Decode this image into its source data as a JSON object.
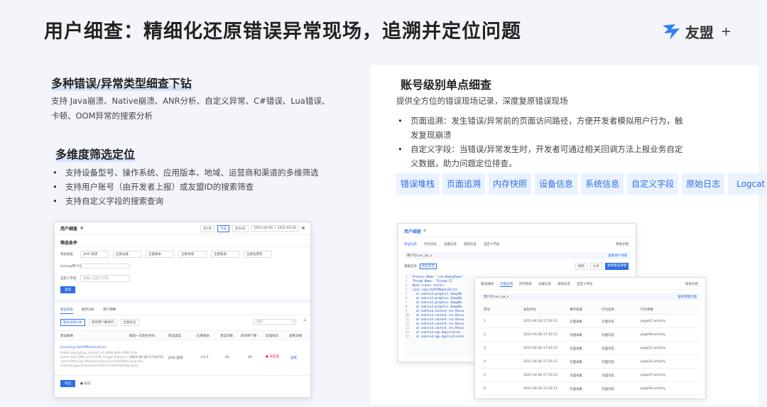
{
  "slide": {
    "title": "用户细查：精细化还原错误异常现场，追溯并定位问题"
  },
  "logo": {
    "name": "友盟",
    "plus": "+"
  },
  "left": {
    "section1": {
      "title": "多种错误/异常类型细查下钻",
      "desc": [
        "支持 Java崩溃、Native崩溃、ANR分析、自定义异常、C#错误、Lua错误、",
        "卡顿、OOM异常的搜索分析"
      ]
    },
    "section2": {
      "title": "多维度筛选定位",
      "bullets": [
        "支持设备型号、操作系统、应用版本、地域、运营商和渠道的多维筛选",
        "支持用户账号（由开发者上报）或友盟ID的搜索筛查",
        "支持自定义字段的搜索查询"
      ]
    }
  },
  "right": {
    "title": "账号级别单点细查",
    "desc": "提供全方位的错误现场记录，深度复原错误现场",
    "bullets": [
      [
        "页面追溯：发生错误/异常前的页面访问路径，方便开发者模拟用户行为，触",
        "发复现崩溃"
      ],
      [
        "自定义字段：当错误/异常发生时，开发者可通过相关回调方法上报业务自定",
        "义数据，助力问题定位排查。"
      ]
    ],
    "tags": [
      "错误堆栈",
      "页面追溯",
      "内存快照",
      "设备信息",
      "系统信息",
      "自定义字段",
      "原始日志",
      "Logcat"
    ]
  },
  "mock_left": {
    "title": "用户细查",
    "header_btns": [
      "近7天",
      "今日",
      "近30天"
    ],
    "date_range": "2021-04-09 ~ 2021-04-28",
    "filter_title": "筛选条件",
    "filter_label1": "错误类型",
    "filters": [
      "JAVA 崩溃",
      "全部设备",
      "全部版本",
      "全部地域",
      "全部渠道",
      "全部运营商"
    ],
    "filter_label2": "Umeng用户ID",
    "filter_label3": "自定义字段",
    "filter_placeholder": "请输入自定义字段",
    "query_btn": "查询",
    "tabs": [
      "错误列表",
      "趋势分析",
      "用户明细"
    ],
    "sub_tabs": [
      "错误详情分析",
      "影响用户数排行",
      "全部状态"
    ],
    "search_placeholder": "搜索",
    "table_headers": [
      "错误摘要",
      "最后一次发生时间",
      "错误类型",
      "应用版本",
      "错误次数",
      "影响用户数",
      "处理状态",
      "查看详情"
    ],
    "row": {
      "summary": "java.lang.OutOfMemoryError",
      "detail": [
        "Failed allocating a byte[] of 4096 with 4096 free",
        "bytes and 2MB until OOM, target footprint",
        "com.demo.app.MainActivity.onCreate(Main.java:42)",
        "android.app.Activity.performCreate(Activity.java)"
      ],
      "time": "2021-04-28 17:43:13",
      "type": "JAVA 崩溃",
      "version": "3.0.0",
      "count": "40",
      "users": "40",
      "status": "未处理",
      "action": "查看"
    },
    "bottom_btn": "导出",
    "bottom_label": "标记"
  },
  "mock_right": {
    "title": "用户细查",
    "top_tabs": [
      "错误信息",
      "行为日志",
      "设备信息",
      "系统信息",
      "自定义字段"
    ],
    "user_label": "用户ID:um_qa_x",
    "right_link": "查看用户详情",
    "fold_label": "基础信息",
    "fold_btn": "导出日志",
    "btns": [
      "刷新",
      "分享",
      "复制错误详情"
    ],
    "help_link": "帮助文档",
    "code_lines": [
      "Process Name: 'com.UmengPower'",
      "Thread Name: 'Thread-12'",
      "Back traces starts.",
      "java.lang.OutOfMemoryError:",
      "  at android.graphics.ImageDe",
      "  at android.graphics.ImageDe",
      "  at android.graphics.ImageDe",
      "  at android.graphics.ImageDe",
      "  at android.content.res.Resou",
      "  at android.content.res.Resou",
      "  at android.content.res.Resou",
      "  at android.content.res.Resou",
      "  at android.content.res.Resou",
      "  at android.app.Application",
      "  at android.app.ApplicationCo"
    ],
    "front": {
      "tabs": [
        "错误堆栈",
        "页面追溯",
        "内存快照",
        "设备信息",
        "系统信息",
        "自定义字段"
      ],
      "user_label": "用户ID:um_qa_x",
      "right_link": "查看完整页面",
      "help_link": "帮助文档",
      "headers": [
        "序号",
        "发生时间",
        "事件来源",
        "行为名称",
        "行为参数"
      ],
      "rows": [
        [
          "1",
          "2021-04-28 17:20:13",
          "页面采集",
          "页面浏览",
          "page07.activity"
        ],
        [
          "2",
          "2021-04-28 17:20:13",
          "页面采集",
          "页面浏览",
          "page08.activity"
        ],
        [
          "3",
          "2021-04-28 17:20:13",
          "页面采集",
          "页面浏览",
          "page21.activity"
        ],
        [
          "4",
          "2021-04-28 17:20:13",
          "页面采集",
          "页面浏览",
          "page26.activity"
        ],
        [
          "5",
          "2021-04-28 17:20:13",
          "页面采集",
          "页面浏览",
          "page47.activity"
        ],
        [
          "6",
          "2021-04-28 17:20:13",
          "页面采集",
          "页面浏览",
          "page09.activity"
        ]
      ]
    }
  },
  "colors": {
    "accent": "#2f6fe4",
    "tag_bg": "#eaf2ff",
    "bg": "#f3f5fa"
  }
}
